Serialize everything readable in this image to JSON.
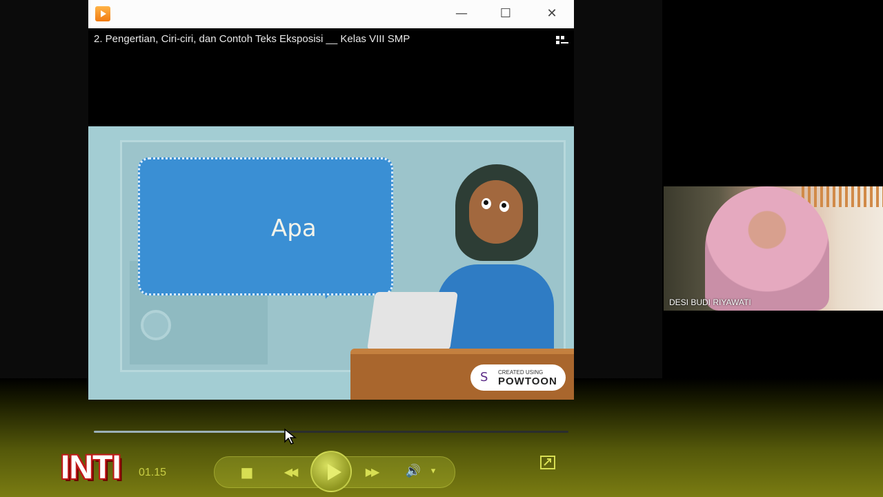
{
  "player": {
    "video_title": "2. Pengertian, Ciri-ciri, dan Contoh Teks Eksposisi __ Kelas VIII SMP",
    "window_controls": {
      "minimize": "—",
      "maximize": "☐",
      "close": "✕"
    },
    "progress_fraction": 0.41,
    "time": "01.15",
    "overlay_label": "INTI"
  },
  "slide": {
    "bubble_text": "Apa",
    "badge_small": "CREATED USING",
    "badge_big": "POWTOON"
  },
  "webcam": {
    "participant_name": "DESI BUDI RIYAWATI"
  },
  "icons": {
    "stop": "■",
    "rewind": "◀◀",
    "forward": "▶▶",
    "volume": "🔊",
    "volume_menu": "▾",
    "powtoon_logo": "S"
  },
  "colors": {
    "control_accent": "#d7de53",
    "bubble": "#3a8fd4",
    "slide_bg": "#a3cdd3"
  }
}
